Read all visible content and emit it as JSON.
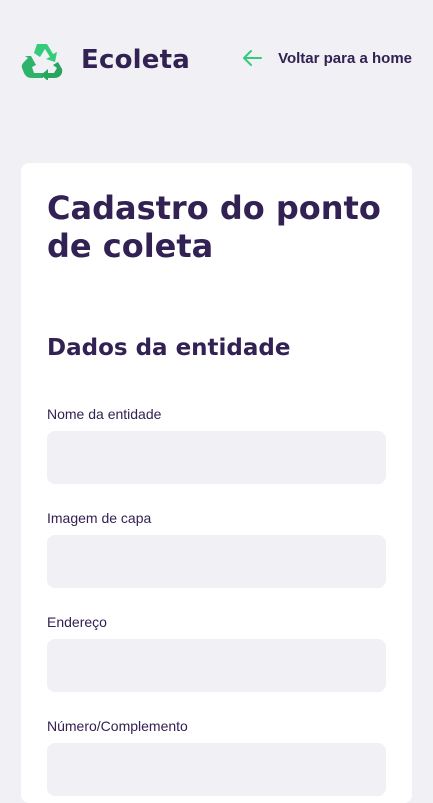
{
  "header": {
    "app_name": "Ecoleta",
    "logo_icon": "recycle-icon",
    "back_icon": "arrow-left-icon",
    "back_label": "Voltar para a home"
  },
  "form": {
    "title": "Cadastro do ponto de coleta",
    "section_title": "Dados da entidade",
    "fields": [
      {
        "label": "Nome da entidade",
        "value": ""
      },
      {
        "label": "Imagem de capa",
        "value": ""
      },
      {
        "label": "Endereço",
        "value": ""
      },
      {
        "label": "Número/Complemento",
        "value": ""
      }
    ]
  },
  "colors": {
    "background": "#f0f0f5",
    "primary_text": "#322153",
    "accent_green": "#34cb79",
    "card": "#ffffff",
    "input_bg": "#f0f0f5"
  }
}
